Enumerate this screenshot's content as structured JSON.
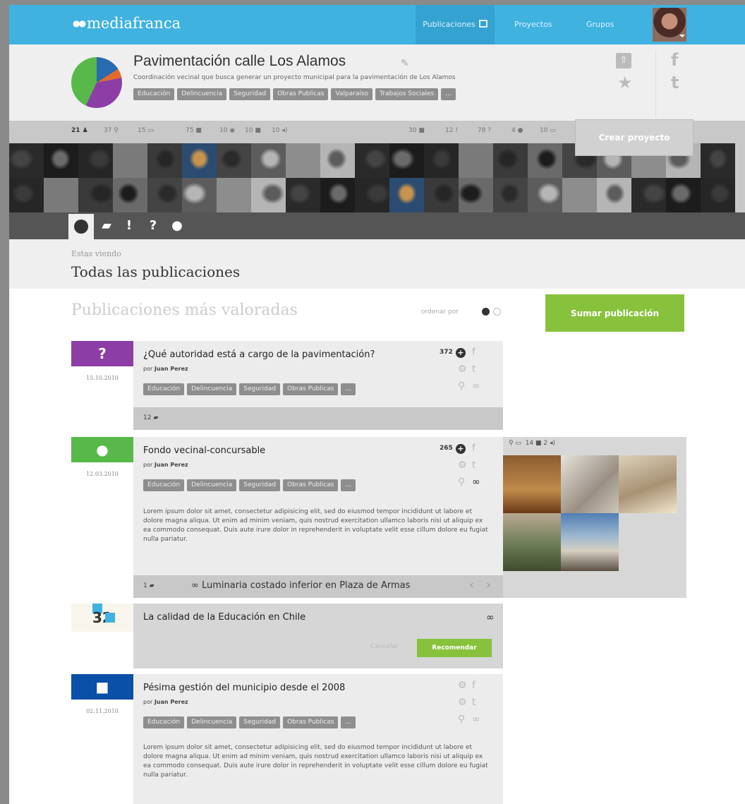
{
  "nav": {
    "logo": "mediafranca",
    "links": [
      "Publicaciones",
      "Proyectos",
      "Grupos"
    ]
  },
  "project": {
    "title": "Pavimentación calle Los Alamos",
    "subtitle": "Coordinación vecinal que busca generar un proyecto municipal para la pavimentación de Los Alamos",
    "tags": [
      "Educación",
      "Delincuencia",
      "Seguridad",
      "Obras Publicas",
      "Valparaíso",
      "Trabajos Sociales",
      "..."
    ],
    "pie_colors": [
      "#2a6bb0",
      "#e46a2c",
      "#8c3ea6",
      "#58b94a"
    ]
  },
  "stats": {
    "members": "21",
    "left": [
      "37",
      "15",
      "75",
      "10",
      "10",
      "10"
    ],
    "right": [
      "30",
      "12",
      "78",
      "4",
      "10"
    ]
  },
  "crear_label": "Crear proyecto",
  "filters": [
    "●",
    "■",
    "!",
    "?",
    "●"
  ],
  "viewing": {
    "label": "Estas viendo",
    "title": "Todas las publicaciones"
  },
  "section": {
    "title": "Publicaciones más valoradas",
    "sort_label": "ordenar por",
    "add_button": "Sumar publicación"
  },
  "posts": [
    {
      "type_icon": "?",
      "date": "15.10.2010",
      "title": "¿Qué autoridad está a cargo de la pavimentación?",
      "author_prefix": "por",
      "author": "Juan Perez",
      "score": "372",
      "tags": [
        "Educación",
        "Delincuencia",
        "Seguridad",
        "Obras Publicas",
        "..."
      ],
      "comments": "12"
    },
    {
      "type_icon": "●",
      "date": "12.03.2010",
      "title": "Fondo vecinal-concursable",
      "author_prefix": "por",
      "author": "Juan Perez",
      "score": "265",
      "tags": [
        "Educación",
        "Delincuencia",
        "Seguridad",
        "Obras Publicas",
        "..."
      ],
      "body": "Lorem ipsum dolor sit amet, consectetur adipisicing elit, sed do eiusmod tempor incididunt ut labore et dolore magna aliqua. Ut enim ad minim veniam, quis nostrud exercitation ullamco laboris nisi ut aliquip ex ea commodo consequat. Duis aute irure dolor in reprehenderit in voluptate velit esse cillum dolore eu fugiat nulla pariatur.",
      "comments": "1",
      "link_label": "Luminaria costado inferior en Plaza de Armas",
      "gallery_counts": [
        "14",
        "2"
      ]
    },
    {
      "type_icon": "■",
      "date": "02.11.2010",
      "title": "Pésima gestión del municipio desde el 2008",
      "author_prefix": "por",
      "author": "Juan Perez",
      "tags": [
        "Educación",
        "Delincuencia",
        "Seguridad",
        "Obras Publicas",
        "..."
      ],
      "body": "Lorem ipsum dolor sit amet, consectetur adipisicing elit, sed do eiusmod tempor incididunt ut labore et dolore magna aliqua. Ut enim ad minim veniam, quis nostrud exercitation ullamco laboris nisi ut aliquip ex ea commodo consequat. Duis aute irure dolor in reprehenderit in voluptate velit esse cillum dolore eu fugiat nulla pariatur."
    }
  ],
  "recommend": {
    "count": "32",
    "title": "La calidad de la Educación en Chile",
    "cancel": "Cancelar",
    "button": "Recomendar"
  },
  "colors": {
    "nav": "#3fb2e0",
    "green": "#88c23d",
    "question": "#8c3ea6",
    "idea": "#58b94a",
    "comment": "#0a4fa8"
  }
}
